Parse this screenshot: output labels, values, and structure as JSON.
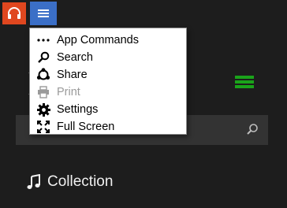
{
  "app": {
    "logo_icon": "headphones-icon",
    "logo_color": "#e0471f"
  },
  "toolbar": {
    "menu_icon": "hamburger-icon",
    "menu_button_color": "#3b6fc7"
  },
  "menu": {
    "items": [
      {
        "label": "App Commands",
        "icon": "more-dots-icon",
        "enabled": true
      },
      {
        "label": "Search",
        "icon": "search-icon",
        "enabled": true
      },
      {
        "label": "Share",
        "icon": "share-icon",
        "enabled": true
      },
      {
        "label": "Print",
        "icon": "printer-icon",
        "enabled": false
      },
      {
        "label": "Settings",
        "icon": "gear-icon",
        "enabled": true
      },
      {
        "label": "Full Screen",
        "icon": "fullscreen-icon",
        "enabled": true
      }
    ]
  },
  "main": {
    "collection_label": "Collection",
    "accent_green": "#1aa31a"
  }
}
